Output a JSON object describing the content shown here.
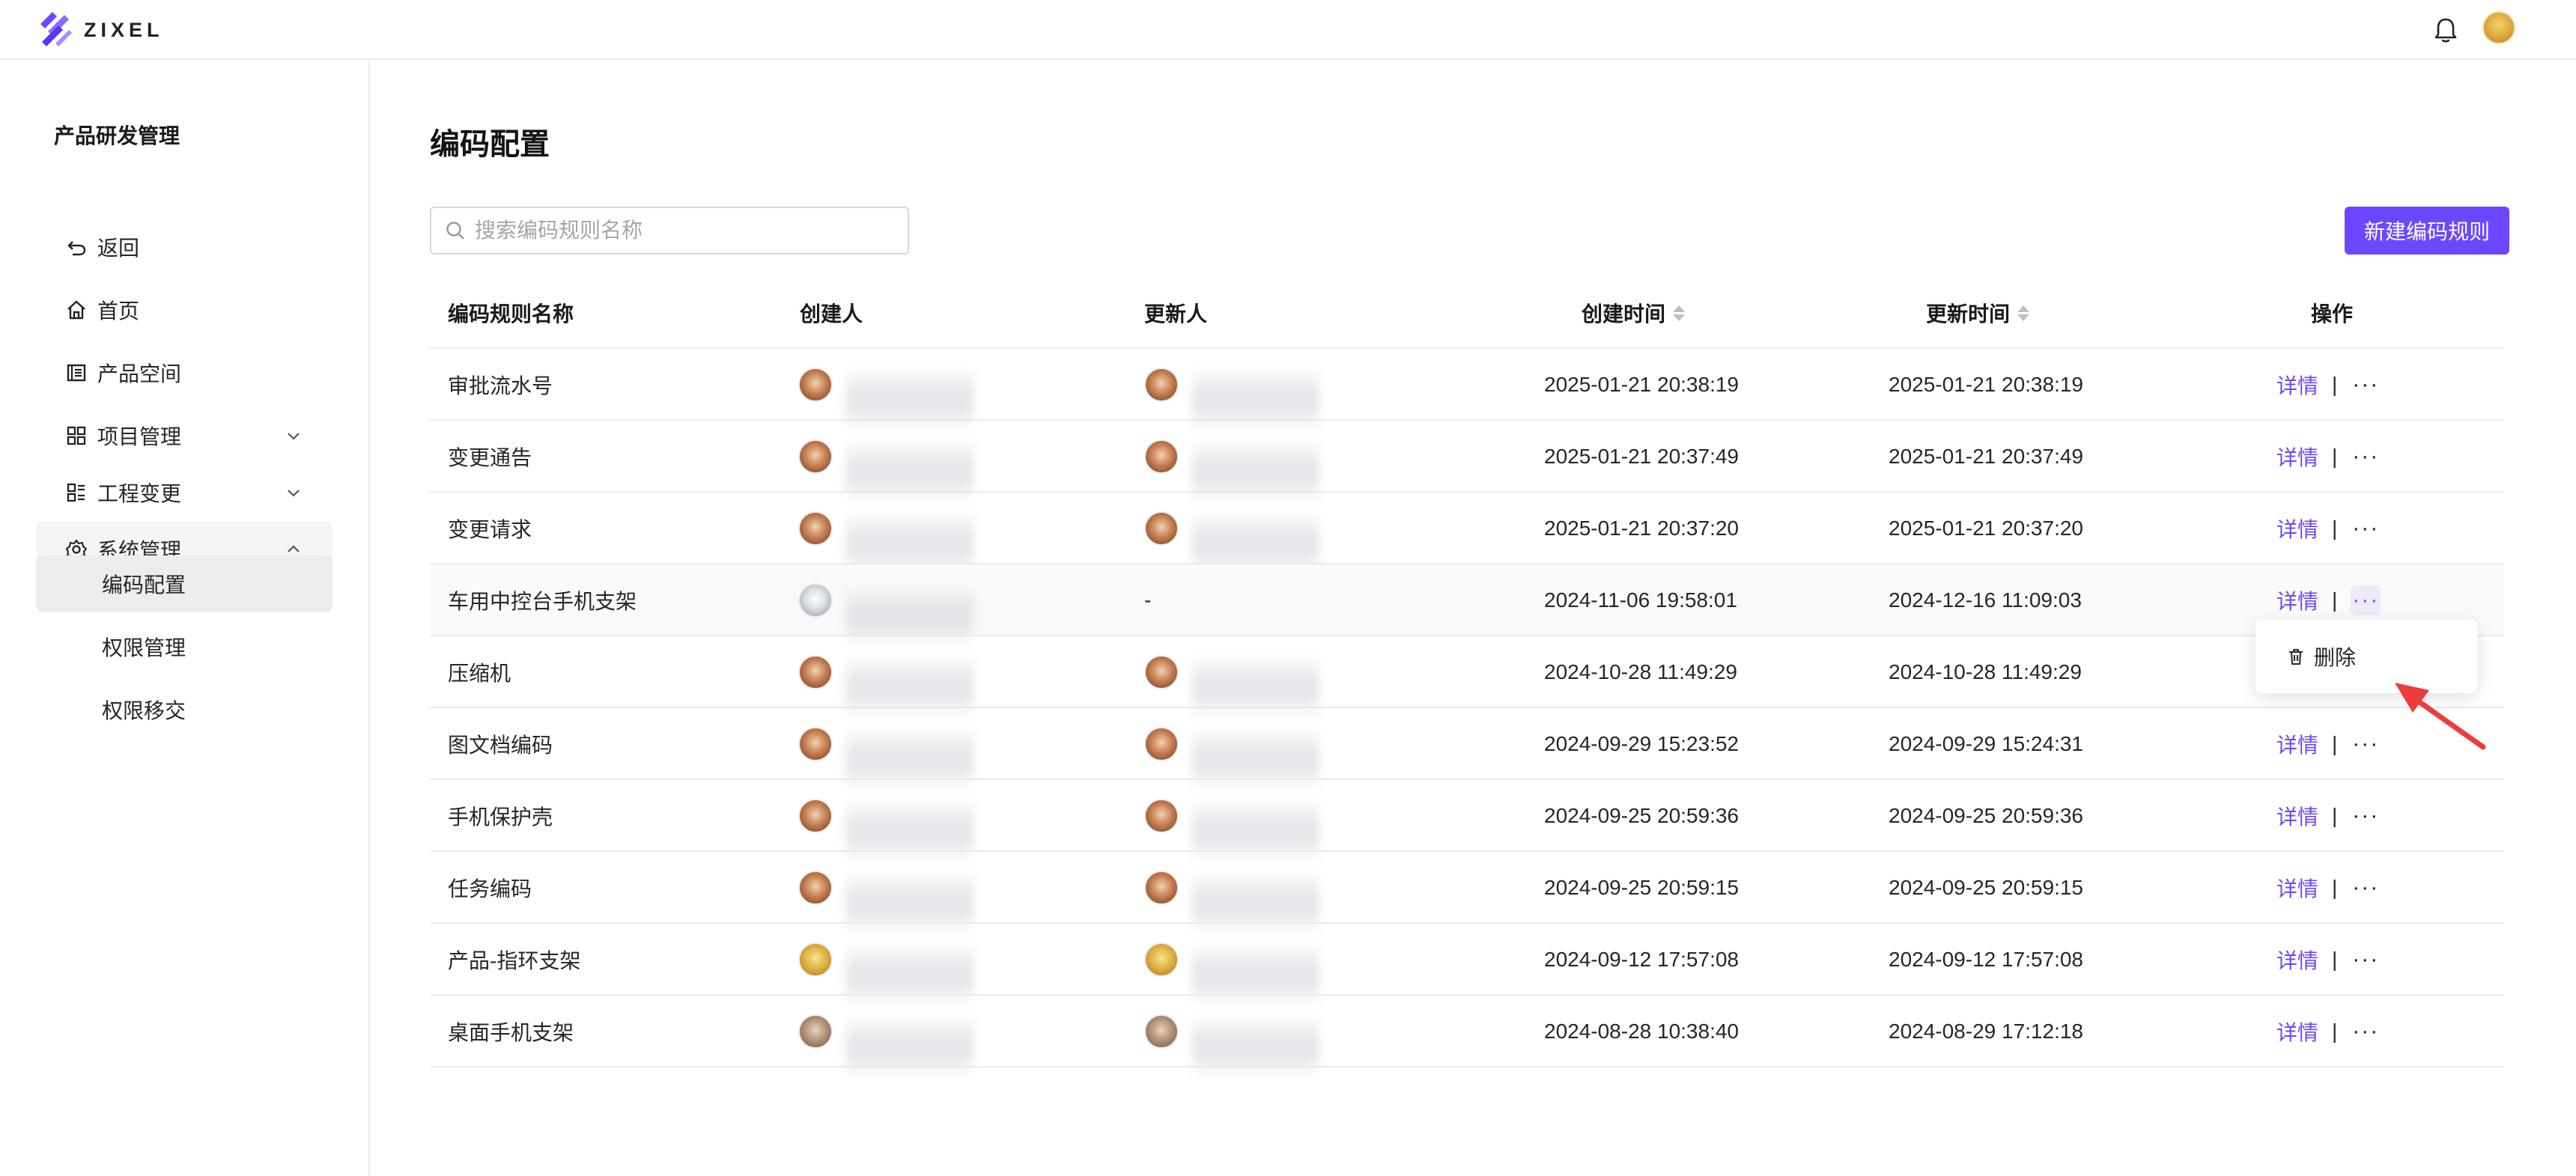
{
  "header": {
    "logo_text": "ZIXEL",
    "brand_color": "#6c47ff"
  },
  "sidebar": {
    "title": "产品研发管理",
    "items": [
      {
        "label": "返回",
        "icon": "back-icon"
      },
      {
        "label": "首页",
        "icon": "home-icon"
      },
      {
        "label": "产品空间",
        "icon": "product-space-icon"
      },
      {
        "label": "项目管理",
        "icon": "project-icon",
        "expandable": true
      },
      {
        "label": "工程变更",
        "icon": "engineering-change-icon",
        "expandable": true
      },
      {
        "label": "系统管理",
        "icon": "settings-gear-icon",
        "expandable": true,
        "expanded": true
      }
    ],
    "sub_items": [
      {
        "label": "编码配置",
        "active": true
      },
      {
        "label": "权限管理"
      },
      {
        "label": "权限移交"
      }
    ]
  },
  "main": {
    "title": "编码配置",
    "search_placeholder": "搜索编码规则名称",
    "new_button": "新建编码规则",
    "columns": [
      "编码规则名称",
      "创建人",
      "更新人",
      "创建时间",
      "更新时间",
      "操作"
    ],
    "rows": [
      {
        "name": "审批流水号",
        "updater": "",
        "created": "2025-01-21 20:38:19",
        "updated": "2025-01-21 20:38:19"
      },
      {
        "name": "变更通告",
        "updater": "",
        "created": "2025-01-21 20:37:49",
        "updated": "2025-01-21 20:37:49"
      },
      {
        "name": "变更请求",
        "updater": "",
        "created": "2025-01-21 20:37:20",
        "updated": "2025-01-21 20:37:20"
      },
      {
        "name": "车用中控台手机支架",
        "updater": "-",
        "created": "2024-11-06 19:58:01",
        "updated": "2024-12-16 11:09:03"
      },
      {
        "name": "压缩机",
        "updater": "",
        "created": "2024-10-28 11:49:29",
        "updated": "2024-10-28 11:49:29"
      },
      {
        "name": "图文档编码",
        "updater": "",
        "created": "2024-09-29 15:23:52",
        "updated": "2024-09-29 15:24:31"
      },
      {
        "name": "手机保护壳",
        "updater": "",
        "created": "2024-09-25 20:59:36",
        "updated": "2024-09-25 20:59:36"
      },
      {
        "name": "任务编码",
        "updater": "",
        "created": "2024-09-25 20:59:15",
        "updated": "2024-09-25 20:59:15"
      },
      {
        "name": "产品-指环支架",
        "updater": "",
        "created": "2024-09-12 17:57:08",
        "updated": "2024-09-12 17:57:08"
      },
      {
        "name": "桌面手机支架",
        "updater": "",
        "created": "2024-08-28 10:38:40",
        "updated": "2024-08-29 17:12:18"
      }
    ],
    "detail_label": "详情",
    "separator": "|",
    "more_label": "···",
    "dropdown": {
      "delete_label": "删除"
    }
  }
}
